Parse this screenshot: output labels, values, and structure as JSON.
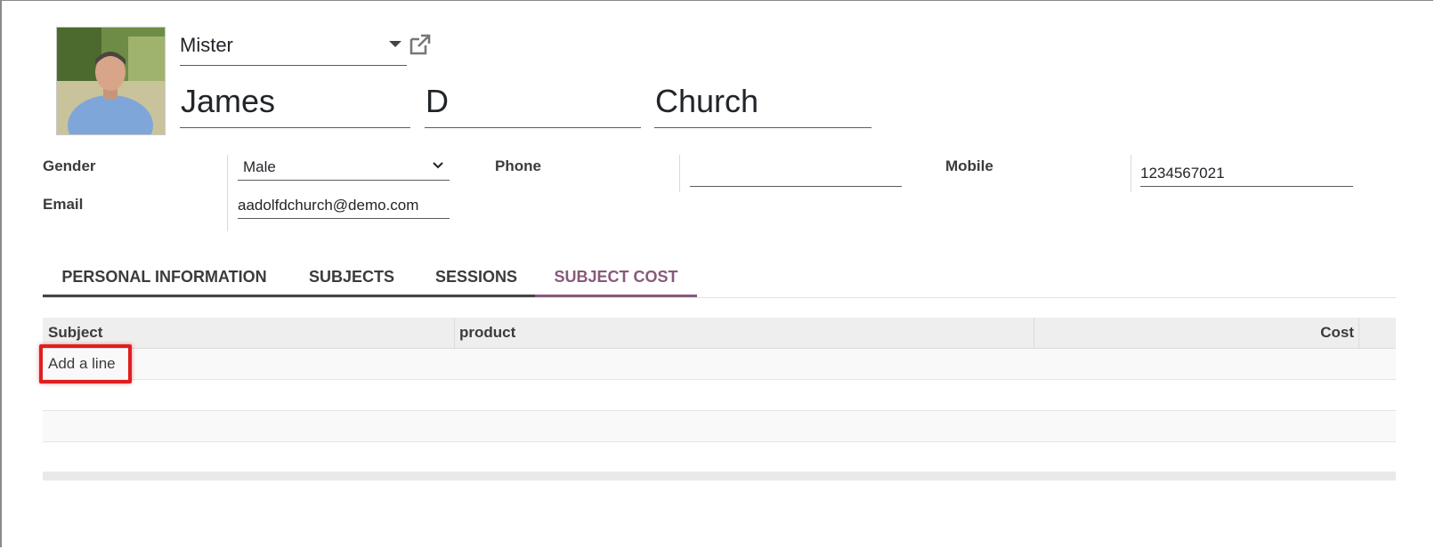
{
  "form": {
    "title_value": "Mister",
    "first_name": "James",
    "middle_name": "D",
    "last_name": "Church",
    "gender_label": "Gender",
    "gender_value": "Male",
    "email_label": "Email",
    "email_value": "aadolfdchurch@demo.com",
    "phone_label": "Phone",
    "phone_value": "",
    "mobile_label": "Mobile",
    "mobile_value": "1234567021"
  },
  "tabs": [
    {
      "label": "PERSONAL INFORMATION"
    },
    {
      "label": "SUBJECTS"
    },
    {
      "label": "SESSIONS"
    },
    {
      "label": "SUBJECT COST"
    }
  ],
  "table": {
    "columns": [
      "Subject",
      "product",
      "Cost"
    ],
    "add_line_label": "Add a line"
  },
  "colors": {
    "accent": "#875a7b",
    "highlight": "#e01e1e"
  },
  "icons": {
    "external": "external-link-icon",
    "caret": "caret-down-icon",
    "chevron": "chevron-down-icon"
  }
}
